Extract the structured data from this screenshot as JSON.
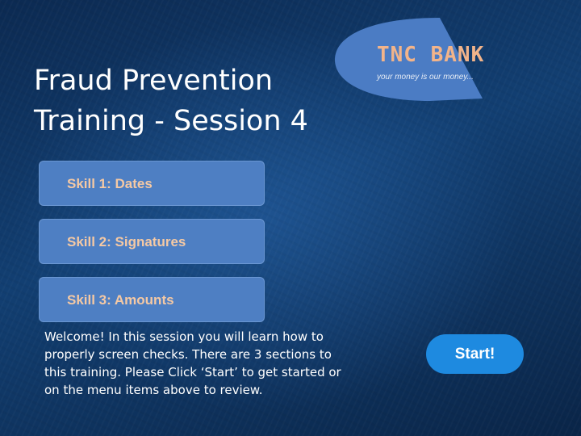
{
  "logo": {
    "name": "TNC BANK",
    "tagline": "your money is our money..."
  },
  "title": "Fraud Prevention Training - Session 4",
  "menu": {
    "items": [
      {
        "label": "Skill 1: Dates"
      },
      {
        "label": "Skill 2: Signatures"
      },
      {
        "label": "Skill 3: Amounts"
      }
    ]
  },
  "welcome_text": "Welcome! In this session you will learn how to properly screen checks. There are 3 sections to this training. Please Click ‘Start’ to get started or on the menu items above to review.",
  "start_button": {
    "label": "Start!"
  },
  "colors": {
    "button_fill": "#4e7fc3",
    "button_text": "#f5c9a4",
    "start_button": "#1e8ae0",
    "logo_text": "#f2b48a"
  }
}
